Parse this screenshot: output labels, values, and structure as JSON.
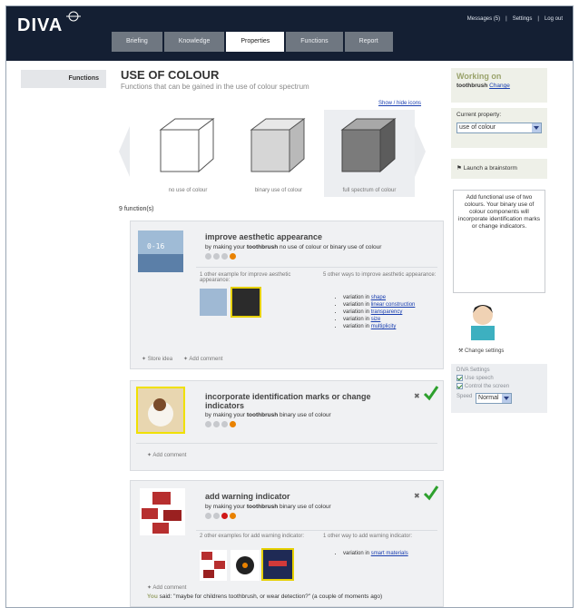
{
  "app": {
    "logo": "DIVA"
  },
  "top_links": [
    "Messages (5)",
    "|",
    "Settings",
    "|",
    "Log out"
  ],
  "tabs": [
    "Briefing",
    "Knowledge",
    "Properties",
    "Functions",
    "Report"
  ],
  "active_tab": "Properties",
  "left_nav": {
    "item": "Functions"
  },
  "page": {
    "title": "USE OF COLOUR",
    "subtitle": "Functions that can be gained in the use of colour spectrum",
    "show_hide": "Show / hide icons",
    "function_count": "9 function(s)"
  },
  "carousel": [
    {
      "label": "no use of colour",
      "shade": "#ffffff"
    },
    {
      "label": "binary use of colour",
      "shade": "#c9c9c9"
    },
    {
      "label": "full spectrum of colour",
      "shade": "#7b7b7b"
    }
  ],
  "cards": [
    {
      "title": "improve aesthetic appearance",
      "by_pre": "by making your ",
      "product": "toothbrush",
      "by_post": " no use of colour or binary use of colour",
      "examples_note": "1 other example for improve aesthetic appearance:",
      "ways_note": "5 other ways to improve aesthetic appearance:",
      "ways": [
        {
          "pre": "variation in ",
          "link": "shape"
        },
        {
          "pre": "variation in ",
          "link": "linear construction"
        },
        {
          "pre": "variation in ",
          "link": "transparency"
        },
        {
          "pre": "variation in ",
          "link": "size"
        },
        {
          "pre": "variation in ",
          "link": "multiplicity"
        }
      ],
      "store_idea": "Store idea",
      "add_comment": "Add comment"
    },
    {
      "title": "incorporate identification marks or change indicators",
      "by_pre": "by making your ",
      "product": "toothbrush",
      "by_post": " binary use of colour",
      "add_comment": "Add comment"
    },
    {
      "title": "add warning indicator",
      "by_pre": "by making your ",
      "product": "toothbrush",
      "by_post": " binary use of colour",
      "examples_note": "2 other examples for add warning indicator:",
      "ways_note": "1 other way to add warning indicator:",
      "ways": [
        {
          "pre": "variation in ",
          "link": "smart materials"
        }
      ],
      "add_comment": "Add comment",
      "comment_user": "You",
      "comment_text": " said: \"maybe for childrens toothbrush, or wear detection?\" (a couple of moments ago)"
    }
  ],
  "right": {
    "working_on": "Working on",
    "product": "toothbrush",
    "change": "Change",
    "current_property_label": "Current property:",
    "current_property_value": "use of colour",
    "brainstorm": "Launch a brainstorm",
    "info": "Add functional use of two colours. Your binary use of colour components will incorporate identification marks or change indicators.",
    "change_settings": "Change settings",
    "settings_title": "DIVA Settings",
    "use_speech": "Use speech",
    "control_screen": "Control the screen",
    "speed_label": "Speed",
    "speed_value": "Normal"
  },
  "colors": {
    "header": "#141f33",
    "accent": "#e98200",
    "check": "#2da02d",
    "link": "#1a3fb0"
  }
}
